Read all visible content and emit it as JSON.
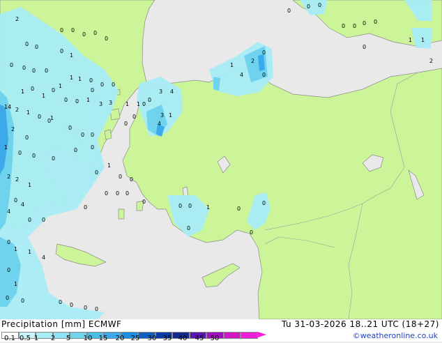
{
  "map": {
    "land_color": "#ccf59a",
    "sea_color": "#e9e9e9",
    "precip_colors": [
      "#a8ecf6",
      "#6fd3ee",
      "#3ca9ea"
    ],
    "point_values": [
      "2",
      "0",
      "0",
      "0",
      "0",
      "0",
      "0",
      "0",
      "0",
      "1",
      "0",
      "0",
      "0",
      "0",
      "1",
      "1",
      "0",
      "0",
      "0",
      "0",
      "1",
      "0",
      "0",
      "1",
      "1",
      "0",
      "0",
      "1",
      "3",
      "3",
      "1",
      "1",
      "14",
      "2",
      "1",
      "0",
      "0",
      "3",
      "4",
      "0",
      "0",
      "0",
      "0",
      "1",
      "0",
      "0",
      "0",
      "3",
      "1",
      "4",
      "2",
      "0",
      "1",
      "0",
      "0",
      "0",
      "0",
      "0",
      "1",
      "0",
      "0",
      "0",
      "2",
      "2",
      "1",
      "0",
      "4",
      "0",
      "4",
      "0",
      "0",
      "2",
      "0",
      "0",
      "4",
      "1",
      "0",
      "0",
      "0",
      "0",
      "0",
      "0",
      "0",
      "0",
      "1",
      "1",
      "2",
      "0",
      "1",
      "1",
      "4",
      "0",
      "1",
      "0",
      "0",
      "0",
      "0",
      "0",
      "0",
      "0",
      "0",
      "1",
      "0",
      "0",
      "0",
      "0",
      "0",
      "0",
      "0",
      "0"
    ]
  },
  "footer": {
    "title": "Precipitation [mm]  ECMWF",
    "valid_time": "Tu 31-03-2026 18..21 UTC (18+27)",
    "credit": "©weatheronline.co.uk",
    "scale_labels": [
      "0.1",
      "0.5",
      "1",
      "2",
      "5",
      "10",
      "15",
      "20",
      "25",
      "30",
      "35",
      "40",
      "45",
      "50"
    ],
    "scale_colors": [
      "#ffffff",
      "#c8f4fb",
      "#a8ecf6",
      "#8ee2f4",
      "#6fd3ee",
      "#48bde6",
      "#3ca9ea",
      "#1c8ee0",
      "#0f5fc2",
      "#0a3aa8",
      "#142a8c",
      "#5a18b0",
      "#a010c0",
      "#d018c8",
      "#f020d8"
    ]
  }
}
